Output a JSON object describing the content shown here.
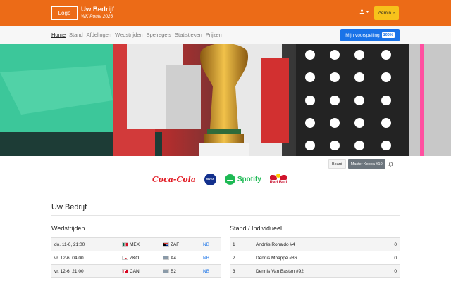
{
  "header": {
    "logo_label": "Logo",
    "company_name": "Uw Bedrijf",
    "subtitle": "WK Poule 2026",
    "user_icon": "user-icon",
    "admin_label": "Admin »"
  },
  "nav": {
    "items": [
      {
        "label": "Home",
        "active": true
      },
      {
        "label": "Stand",
        "active": false
      },
      {
        "label": "Afdelingen",
        "active": false
      },
      {
        "label": "Wedstrijden",
        "active": false
      },
      {
        "label": "Spelregels",
        "active": false
      },
      {
        "label": "Statistieken",
        "active": false
      },
      {
        "label": "Prijzen",
        "active": false
      }
    ],
    "prediction_button": "Mijn voorspelling",
    "prediction_badge": "100%"
  },
  "controls": {
    "board_label": "Board",
    "master_label": "Master Koppa #10",
    "bell_icon": "bell-icon"
  },
  "sponsors": {
    "cocacola": "Coca-Cola",
    "nivea": "NIVEA",
    "spotify": "Spotify",
    "redbull": "Red Bull"
  },
  "company_heading": "Uw Bedrijf",
  "matches": {
    "title": "Wedstrijden",
    "rows": [
      {
        "date": "do. 11-6, 21:00",
        "home": "MEX",
        "home_flag": "mex",
        "away": "ZAF",
        "away_flag": "zaf",
        "status": "NB"
      },
      {
        "date": "vr. 12-6, 04:00",
        "home": "ZKO",
        "home_flag": "kor",
        "away": "A4",
        "away_flag": "tbd",
        "status": "NB"
      },
      {
        "date": "vr. 12-6, 21:00",
        "home": "CAN",
        "home_flag": "can",
        "away": "B2",
        "away_flag": "tbd",
        "status": "NB"
      }
    ]
  },
  "standings": {
    "title": "Stand / Individueel",
    "rows": [
      {
        "rank": "1",
        "name": "Andrés Ronaldo #4",
        "points": "0"
      },
      {
        "rank": "2",
        "name": "Dennis Mbappé #86",
        "points": "0"
      },
      {
        "rank": "3",
        "name": "Dennis Van Basten #92",
        "points": "0"
      }
    ]
  },
  "colors": {
    "header_bg": "#ec6b17",
    "admin_bg": "#f7c21b",
    "primary": "#1a73e8"
  }
}
